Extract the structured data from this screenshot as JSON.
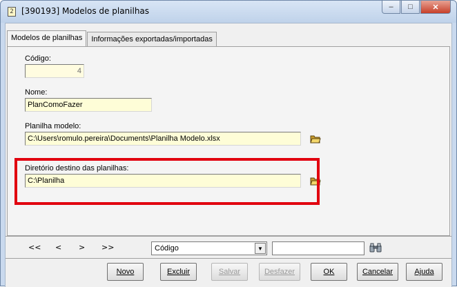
{
  "window": {
    "icon_glyph": "2",
    "title": "[390193]  Modelos de planilhas",
    "controls": {
      "minimize": "–",
      "maximize": "□",
      "close": "✕"
    }
  },
  "tabs": [
    {
      "label": "Modelos de planilhas",
      "active": true
    },
    {
      "label": "Informações exportadas/importadas",
      "active": false
    }
  ],
  "form": {
    "codigo": {
      "label": "Código:",
      "value": "4"
    },
    "nome": {
      "label": "Nome:",
      "value": "PlanComoFazer"
    },
    "planilha_modelo": {
      "label": "Planilha modelo:",
      "value": "C:\\Users\\romulo.pereira\\Documents\\Planilha Modelo.xlsx"
    },
    "diretorio_destino": {
      "label": "Diretório destino das planilhas:",
      "value": "C:\\Planilha"
    }
  },
  "navigation": {
    "first": "<<",
    "prev": "<",
    "next": ">",
    "last": ">>",
    "search_field": "Código",
    "search_value": ""
  },
  "buttons": [
    {
      "label": "Novo",
      "enabled": true
    },
    {
      "label": "Excluir",
      "enabled": true
    },
    {
      "label": "Salvar",
      "enabled": false
    },
    {
      "label": "Desfazer",
      "enabled": false
    },
    {
      "label": "OK",
      "enabled": true
    },
    {
      "label": "Cancelar",
      "enabled": true
    },
    {
      "label": "Ajuda",
      "enabled": true
    }
  ],
  "colors": {
    "highlight": "#e1000f",
    "field_background": "#fefdd7"
  }
}
